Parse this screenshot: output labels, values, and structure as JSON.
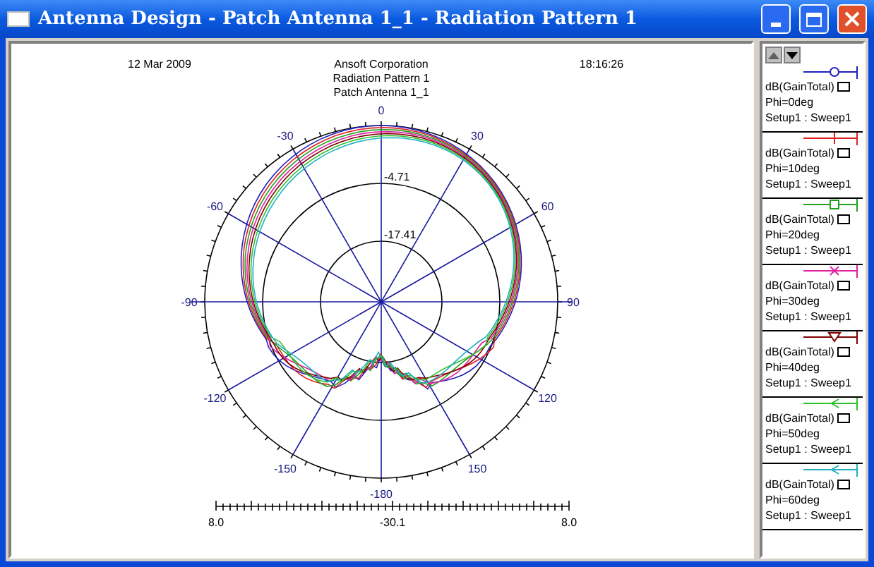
{
  "window": {
    "title": "Antenna Design - Patch Antenna 1_1 - Radiation Pattern 1"
  },
  "plot": {
    "date": "12 Mar 2009",
    "company": "Ansoft Corporation",
    "title": "Radiation Pattern 1",
    "subtitle": "Patch Antenna 1_1",
    "time": "18:16:26",
    "angle_labels": [
      "0",
      "30",
      "60",
      "90",
      "120",
      "150",
      "-180",
      "-150",
      "-120",
      "-90",
      "-60",
      "-30"
    ],
    "ring_labels": [
      "-4.71",
      "-17.41"
    ],
    "scale_labels": [
      "8.0",
      "-30.1",
      "8.0"
    ]
  },
  "legend": [
    {
      "quantity": "dB(GainTotal)",
      "phi": "Phi=0deg",
      "setup": "Setup1 : Sweep1",
      "kind": "circle",
      "color": "#2020c0"
    },
    {
      "quantity": "dB(GainTotal)",
      "phi": "Phi=10deg",
      "setup": "Setup1 : Sweep1",
      "kind": "plus",
      "color": "#e02020"
    },
    {
      "quantity": "dB(GainTotal)",
      "phi": "Phi=20deg",
      "setup": "Setup1 : Sweep1",
      "kind": "square",
      "color": "#20a020"
    },
    {
      "quantity": "dB(GainTotal)",
      "phi": "Phi=30deg",
      "setup": "Setup1 : Sweep1",
      "kind": "cross",
      "color": "#e020a0"
    },
    {
      "quantity": "dB(GainTotal)",
      "phi": "Phi=40deg",
      "setup": "Setup1 : Sweep1",
      "kind": "triangle",
      "color": "#800000"
    },
    {
      "quantity": "dB(GainTotal)",
      "phi": "Phi=50deg",
      "setup": "Setup1 : Sweep1",
      "kind": "arrow",
      "color": "#30c030"
    },
    {
      "quantity": "dB(GainTotal)",
      "phi": "Phi=60deg",
      "setup": "Setup1 : Sweep1",
      "kind": "arrow",
      "color": "#20b0c0"
    }
  ]
}
